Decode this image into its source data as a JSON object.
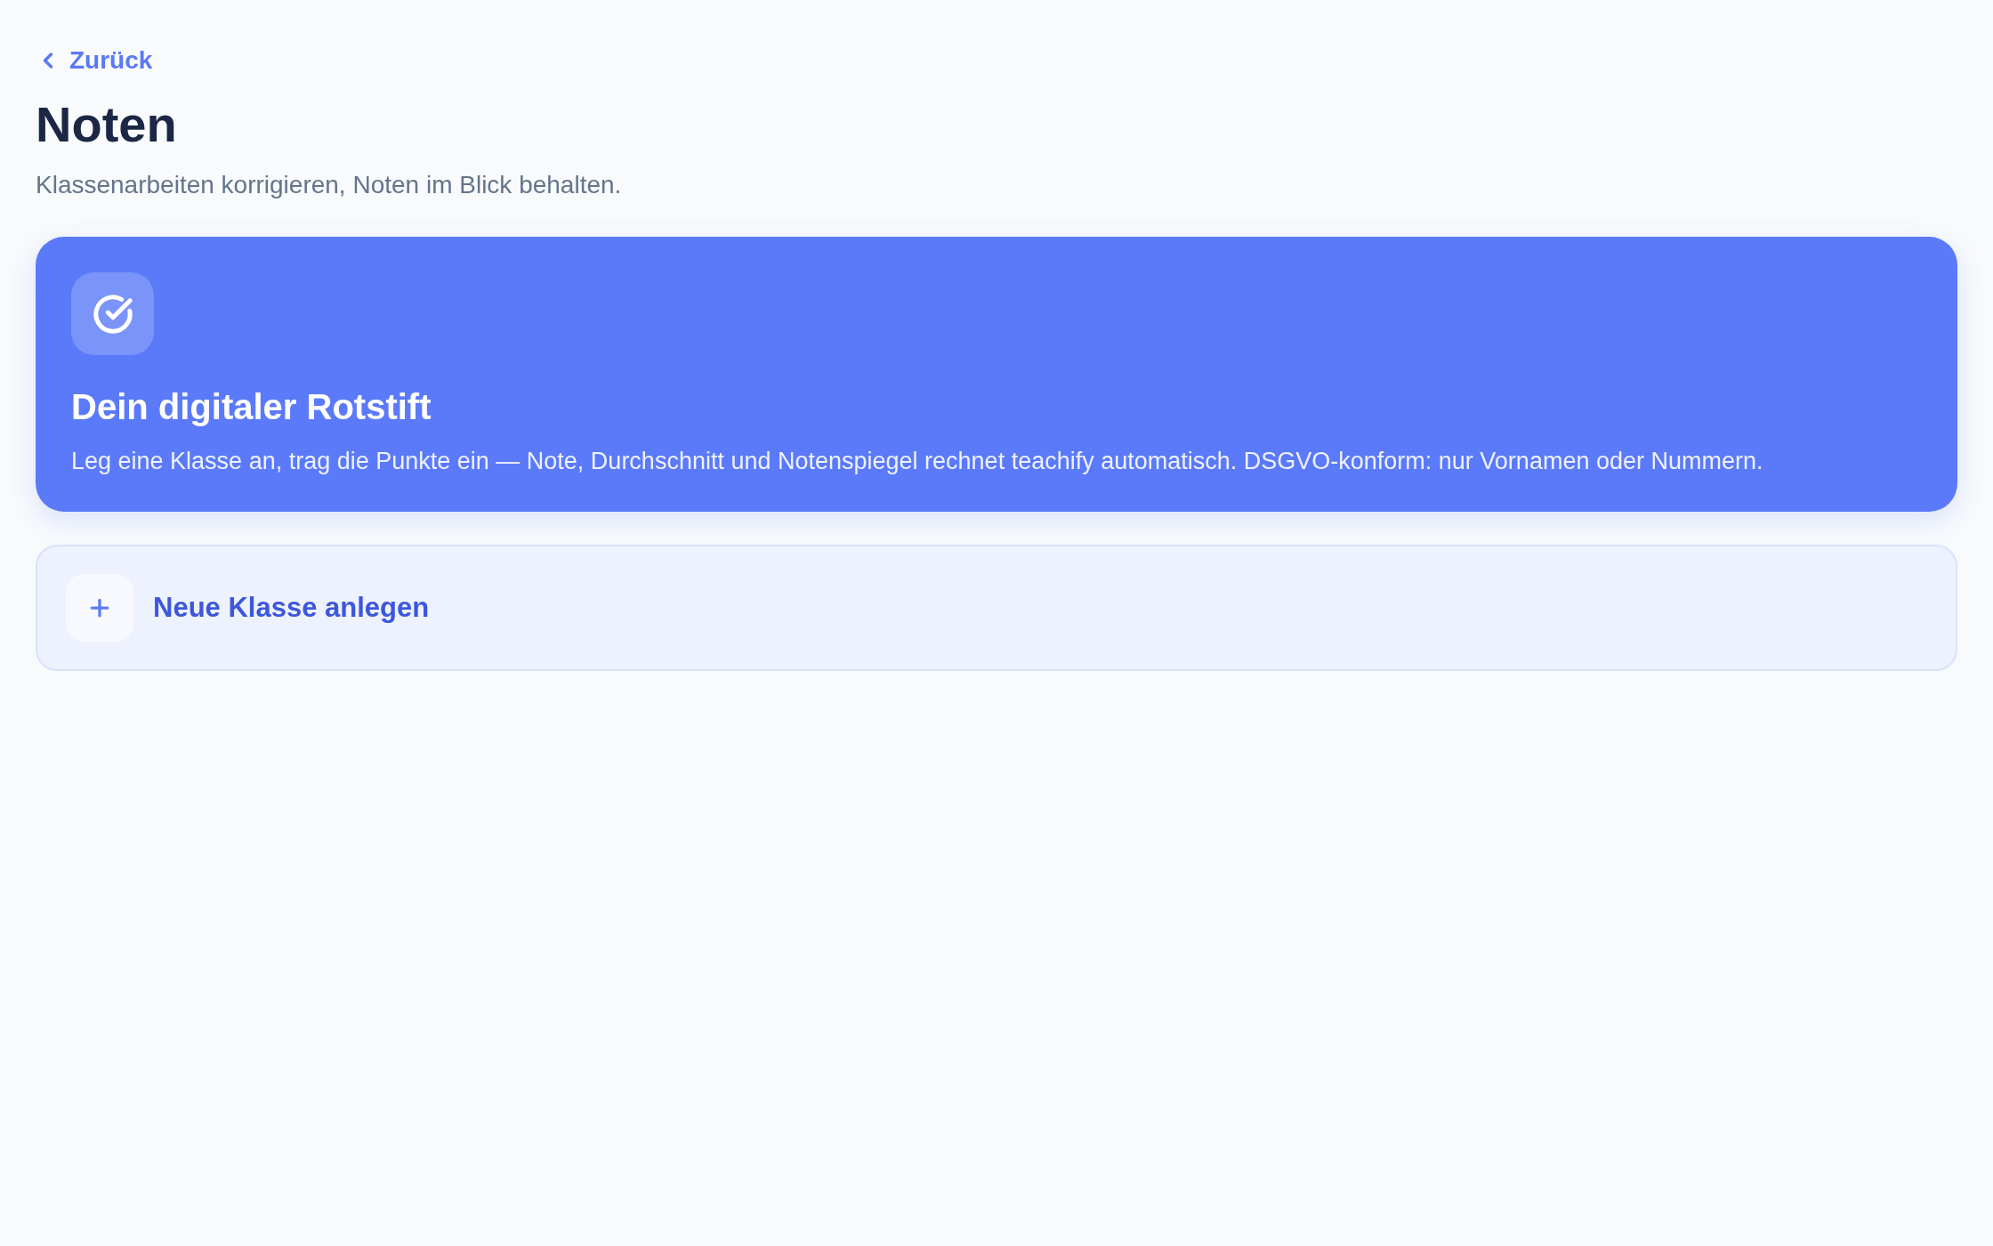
{
  "back_link": {
    "label": "Zurück"
  },
  "header": {
    "title": "Noten",
    "subtitle": "Klassenarbeiten korrigieren, Noten im Blick behalten."
  },
  "hero_card": {
    "title": "Dein digitaler Rotstift",
    "description": "Leg eine Klasse an, trag die Punkte ein — Note, Durchschnitt und Notenspiegel rechnet teachify automatisch. DSGVO-konform: nur Vornamen oder Nummern."
  },
  "new_class_button": {
    "label": "Neue Klasse anlegen"
  }
}
